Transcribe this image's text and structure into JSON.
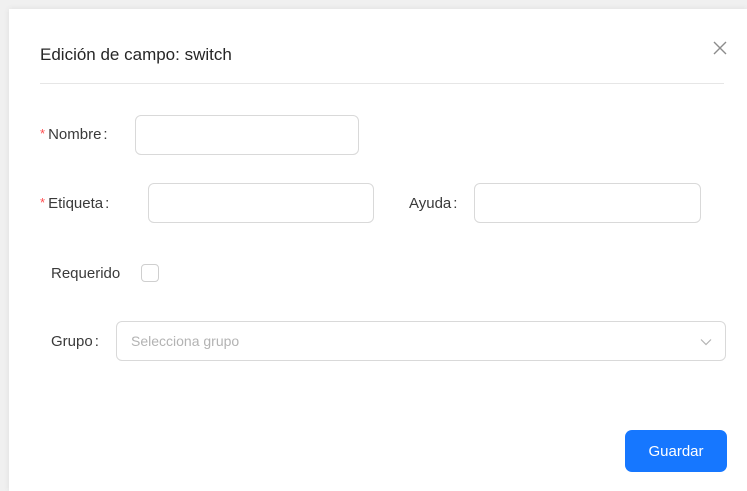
{
  "dialog": {
    "title": "Edición de campo: switch",
    "close_icon": "close-icon"
  },
  "form": {
    "required_mark": "*",
    "nombre": {
      "label": "Nombre",
      "value": "",
      "required": true
    },
    "etiqueta": {
      "label": "Etiqueta",
      "value": "",
      "required": true
    },
    "ayuda": {
      "label": "Ayuda",
      "value": ""
    },
    "requerido": {
      "label": "Requerido",
      "checked": false
    },
    "grupo": {
      "label": "Grupo",
      "placeholder": "Selecciona grupo",
      "value": ""
    },
    "colon": ":"
  },
  "actions": {
    "save_label": "Guardar"
  },
  "colors": {
    "primary": "#1677ff",
    "required": "#ff4d4f",
    "border": "#d9d9d9"
  }
}
